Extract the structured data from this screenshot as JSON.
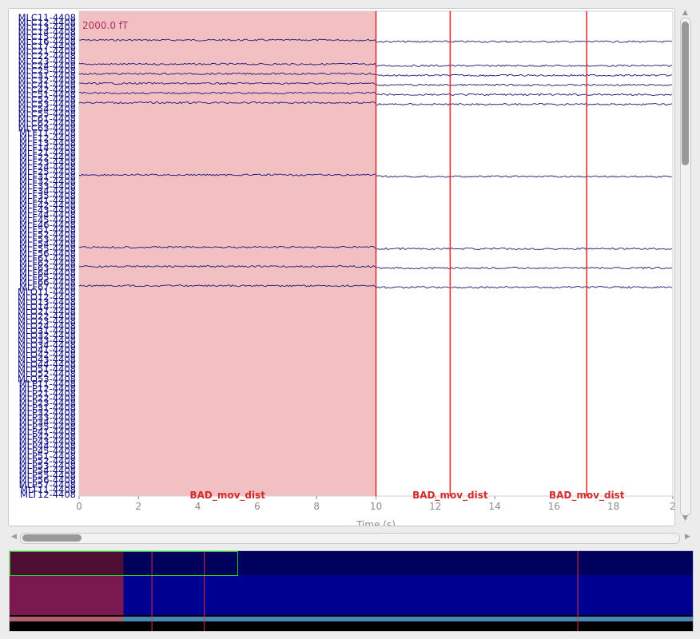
{
  "scale_label": "2000.0 fT",
  "xaxis": {
    "label": "Time (s)",
    "ticks": [
      "0",
      "2",
      "4",
      "6",
      "8",
      "10",
      "12",
      "14",
      "16",
      "18",
      "2"
    ],
    "range": [
      0,
      20
    ]
  },
  "channels": [
    "MLC11-4408",
    "MLC12-4408",
    "MLC13-4408",
    "MLC14-4408",
    "MLC15-4408",
    "MLC16-4408",
    "MLC17-4408",
    "MLC21-4408",
    "MLC22-4408",
    "MLC23-4408",
    "MLC24-4408",
    "MLC25-4408",
    "MLC31-4408",
    "MLC32-4408",
    "MLC41-4408",
    "MLC42-4408",
    "MLC51-4408",
    "MLC52-4408",
    "MLC53-4408",
    "MLC54-4408",
    "MLC55-4408",
    "MLC61-4408",
    "MLC62-4408",
    "MLC63-4408",
    "MLF11-4408",
    "MLF12-4408",
    "MLF13-4408",
    "MLF14-4408",
    "MLF21-4408",
    "MLF22-4408",
    "MLF23-4408",
    "MLF24-4408",
    "MLF25-4408",
    "MLF31-4408",
    "MLF32-4408",
    "MLF33-4408",
    "MLF34-4408",
    "MLF35-4408",
    "MLF41-4408",
    "MLF42-4408",
    "MLF43-4408",
    "MLF44-4408",
    "MLF45-4408",
    "MLF46-4408",
    "MLF51-4408",
    "MLF52-4408",
    "MLF53-4408",
    "MLF54-4408",
    "MLF55-4408",
    "MLF56-4408",
    "MLF61-4408",
    "MLF62-4408",
    "MLF63-4408",
    "MLF64-4408",
    "MLF65-4408",
    "MLF66-4408",
    "MLF67-4408",
    "MLO11-4408",
    "MLO12-4408",
    "MLO13-4408",
    "MLO14-4408",
    "MLO21-4408",
    "MLO22-4408",
    "MLO23-4408",
    "MLO24-4408",
    "MLO31-4408",
    "MLO32-4408",
    "MLO33-4408",
    "MLO34-4408",
    "MLO41-4408",
    "MLO42-4408",
    "MLO43-4408",
    "MLO44-4408",
    "MLO51-4408",
    "MLO52-4408",
    "MLO53-4408",
    "MLP11-4408",
    "MLP12-4408",
    "MLP21-4408",
    "MLP22-4408",
    "MLP23-4408",
    "MLP31-4408",
    "MLP32-4408",
    "MLP33-4408",
    "MLP34-4408",
    "MLP35-4408",
    "MLP41-4408",
    "MLP42-4408",
    "MLP43-4408",
    "MLP44-4408",
    "MLP45-4408",
    "MLP51-4408",
    "MLP52-4408",
    "MLP53-4408",
    "MLP54-4408",
    "MLP55-4408",
    "MLP56-4408",
    "MLP57-4408",
    "MLT11-4408",
    "MLT12-4408"
  ],
  "annotations": [
    {
      "label": "BAD_mov_dist",
      "start": 0,
      "end": 10
    },
    {
      "label": "BAD_mov_dist",
      "start": 12.5,
      "end": 12.5
    },
    {
      "label": "BAD_mov_dist",
      "start": 17.1,
      "end": 17.1
    }
  ],
  "traces": [
    {
      "channel": 5,
      "offset": 0
    },
    {
      "channel": 10,
      "offset": 0
    },
    {
      "channel": 12,
      "offset": 0
    },
    {
      "channel": 14,
      "offset": 0
    },
    {
      "channel": 16,
      "offset": 0
    },
    {
      "channel": 18,
      "offset": 0
    },
    {
      "channel": 33,
      "offset": 0
    },
    {
      "channel": 48,
      "offset": 0
    },
    {
      "channel": 52,
      "offset": 0
    },
    {
      "channel": 56,
      "offset": 0
    }
  ],
  "colors": {
    "trace": "#1a1a7a",
    "bad_fill": "#f2bfc3",
    "annotation_line": "#e03030",
    "annotation_text": "#d42a2a",
    "scale_text": "#b03060",
    "overview_bg": "#000090",
    "overview_bad": "#7a1850",
    "viewport_box": "#22d022"
  },
  "overview": {
    "total_duration": 60,
    "view_start": 0,
    "view_end": 20
  }
}
